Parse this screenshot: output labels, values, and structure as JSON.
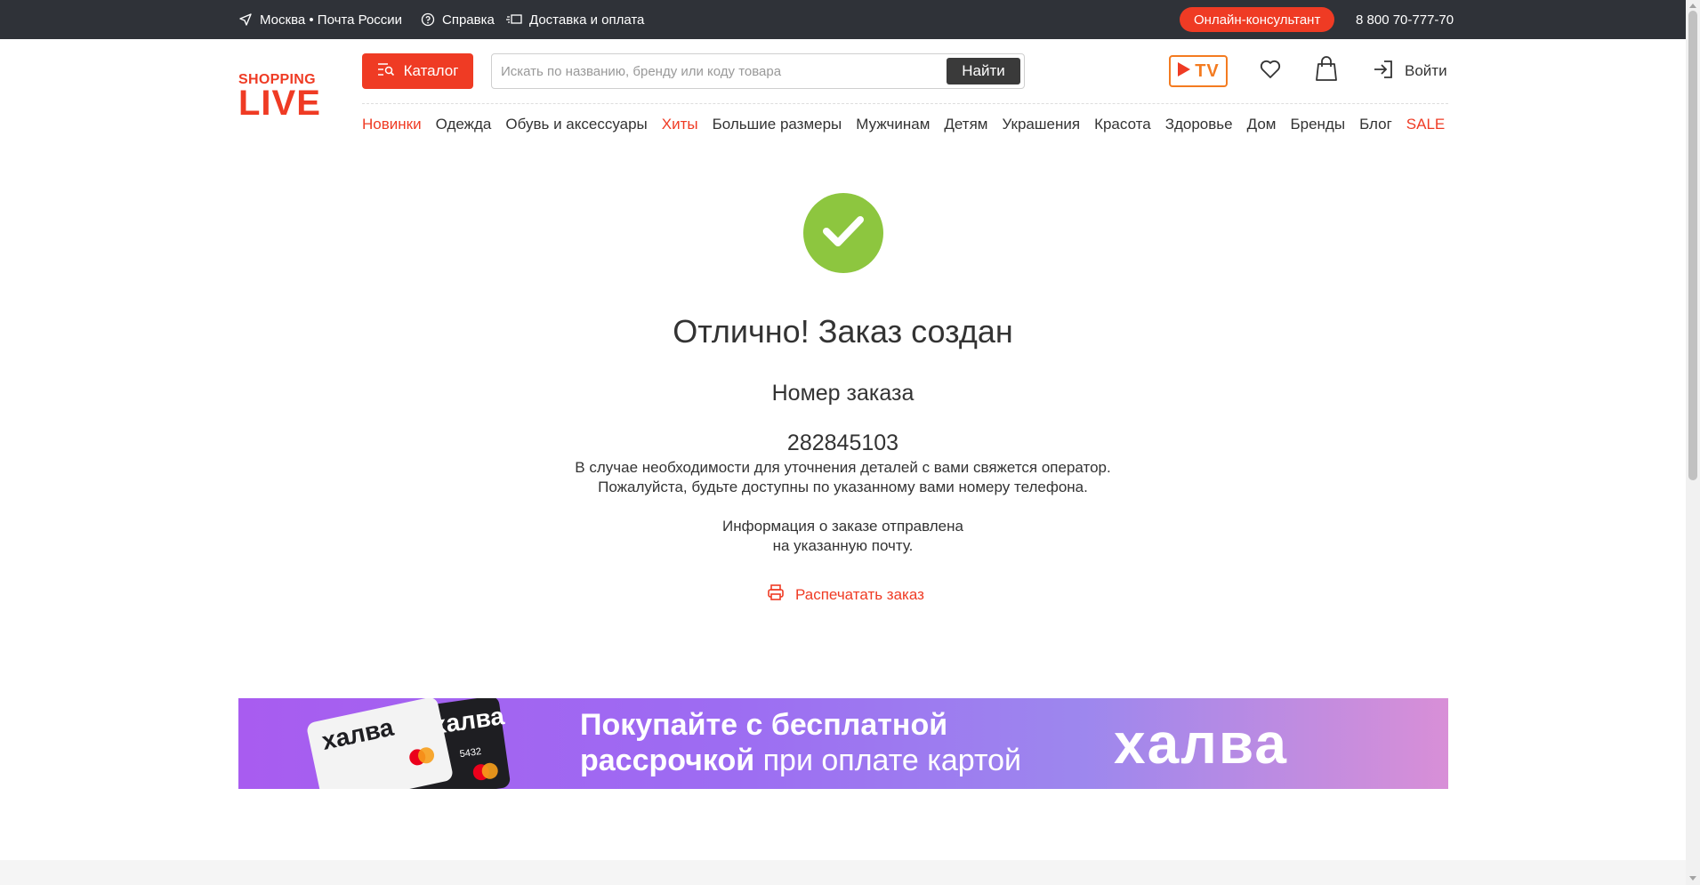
{
  "topbar": {
    "location": "Москва • Почта России",
    "help": "Справка",
    "delivery": "Доставка и оплата",
    "consultant": "Онлайн-консультант",
    "phone": "8 800 70-777-70"
  },
  "logo": {
    "line1": "SHOPPING",
    "line2": "LIVE"
  },
  "header": {
    "catalog": "Каталог",
    "search_placeholder": "Искать по названию, бренду или коду товара",
    "search_button": "Найти",
    "tv": "TV",
    "login": "Войти"
  },
  "nav": [
    {
      "label": "Новинки",
      "color": "#ef3b24"
    },
    {
      "label": "Одежда"
    },
    {
      "label": "Обувь и аксессуары"
    },
    {
      "label": "Хиты",
      "color": "#ef3b24"
    },
    {
      "label": "Большие размеры"
    },
    {
      "label": "Мужчинам"
    },
    {
      "label": "Детям"
    },
    {
      "label": "Украшения"
    },
    {
      "label": "Красота"
    },
    {
      "label": "Здоровье"
    },
    {
      "label": "Дом"
    },
    {
      "label": "Бренды"
    },
    {
      "label": "Блог"
    },
    {
      "label": "SALE",
      "color": "#ef3b24"
    }
  ],
  "confirmation": {
    "title": "Отлично! Заказ создан",
    "order_label": "Номер заказа",
    "order_number": "282845103",
    "info_line1": "В случае необходимости для уточнения деталей с вами свяжется оператор.",
    "info_line2": "Пожалуйста, будьте доступны по указанному вами номеру телефона.",
    "info_line3": "Информация о заказе отправлена",
    "info_line4": "на указанную почту.",
    "print": "Распечатать заказ"
  },
  "banner": {
    "bold1": "Покупайте с бесплатной",
    "bold2": "рассрочкой",
    "rest": " при оплате картой",
    "brand": "халва",
    "card_text": "халва",
    "card_number": "5432"
  },
  "colors": {
    "accent": "#ef3b24",
    "success": "#8dc63f",
    "topbar": "#2f3238",
    "tv": "#f47b20"
  },
  "icons": {
    "location": "location-arrow-icon",
    "help": "question-circle-icon",
    "delivery": "truck-icon",
    "catalog": "catalog-menu-icon",
    "favorites": "heart-icon",
    "cart": "shopping-bag-icon",
    "login": "login-arrow-icon",
    "success": "checkmark-icon",
    "print": "printer-icon"
  }
}
